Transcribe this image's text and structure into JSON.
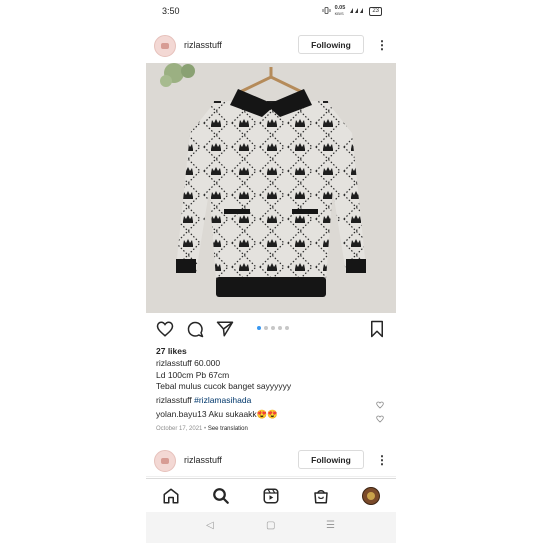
{
  "status_bar": {
    "time": "3:50",
    "net_speed": "0.05",
    "net_unit": "KB/S",
    "battery": "23"
  },
  "post": {
    "username": "rizlasstuff",
    "follow_label": "Following",
    "likes": "27 likes",
    "caption_username": "rizlasstuff",
    "caption_lines": [
      "60.000",
      "Ld 100cm Pb 67cm",
      "Tebal mulus cucok banget sayyyyyy"
    ],
    "hashtag_username": "rizlasstuff",
    "hashtag": "#rizlamasihada",
    "comment_username": "yolan.bayu13",
    "comment_text": "Aku sukaakk😍😍",
    "date": "October 17, 2021",
    "see_translation": "See translation",
    "carousel_count": 5,
    "carousel_active": 0
  },
  "next_post": {
    "username": "rizlasstuff",
    "follow_label": "Following"
  },
  "colors": {
    "accent": "#3897f0",
    "hashtag": "#00376b",
    "muted": "#8e8e8e"
  },
  "icons": {
    "actions": [
      "heart-icon",
      "comment-icon",
      "share-icon",
      "bookmark-icon"
    ],
    "nav": [
      "home-icon",
      "search-icon",
      "reels-icon",
      "shop-icon",
      "profile-avatar"
    ]
  }
}
